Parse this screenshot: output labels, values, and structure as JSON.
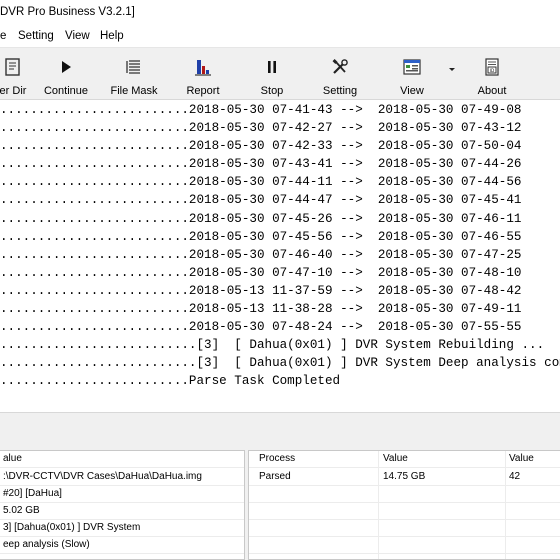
{
  "window": {
    "title": "DVR Pro Business V3.2.1]"
  },
  "menu": [
    "e",
    "Setting",
    "View",
    "Help"
  ],
  "toolbar": {
    "buttons": [
      {
        "name": "enter-dir-button",
        "icon": "folder-icon",
        "label": "er Dir"
      },
      {
        "name": "continue-button",
        "icon": "play-icon",
        "label": "Continue"
      },
      {
        "name": "file-mask-button",
        "icon": "list-icon",
        "label": "File Mask"
      },
      {
        "name": "report-button",
        "icon": "bar-chart-icon",
        "label": "Report"
      },
      {
        "name": "stop-button",
        "icon": "pause-icon",
        "label": "Stop"
      },
      {
        "name": "setting-button",
        "icon": "tools-icon",
        "label": "Setting"
      },
      {
        "name": "view-button",
        "icon": "window-icon",
        "label": "View"
      },
      {
        "name": "about-button",
        "icon": "id-card-icon",
        "label": "About"
      }
    ]
  },
  "log": [
    ".........................2018-05-30 07-41-43 -->  2018-05-30 07-49-08",
    ".........................2018-05-30 07-42-27 -->  2018-05-30 07-43-12",
    ".........................2018-05-30 07-42-33 -->  2018-05-30 07-50-04",
    ".........................2018-05-30 07-43-41 -->  2018-05-30 07-44-26",
    ".........................2018-05-30 07-44-11 -->  2018-05-30 07-44-56",
    ".........................2018-05-30 07-44-47 -->  2018-05-30 07-45-41",
    ".........................2018-05-30 07-45-26 -->  2018-05-30 07-46-11",
    ".........................2018-05-30 07-45-56 -->  2018-05-30 07-46-55",
    ".........................2018-05-30 07-46-40 -->  2018-05-30 07-47-25",
    ".........................2018-05-30 07-47-10 -->  2018-05-30 07-48-10",
    ".........................2018-05-13 11-37-59 -->  2018-05-30 07-48-42",
    ".........................2018-05-13 11-38-28 -->  2018-05-30 07-49-11",
    ".........................2018-05-30 07-48-24 -->  2018-05-30 07-55-55",
    "..........................[3]  [ Dahua(0x01) ] DVR System Rebuilding ...",
    "..........................[3]  [ Dahua(0x01) ] DVR System Deep analysis comple",
    ".........................Parse Task Completed"
  ],
  "left_panel": {
    "header": "alue",
    "rows": [
      ":\\DVR-CCTV\\DVR Cases\\DaHua\\DaHua.img",
      "#20] [DaHua]",
      "5.02 GB",
      "3]  [Dahua(0x01) ] DVR System",
      "eep analysis (Slow)"
    ]
  },
  "right_panel": {
    "headers": [
      "Process",
      "Value",
      "Value"
    ],
    "rows": [
      [
        "Parsed",
        "14.75 GB",
        "42"
      ]
    ]
  }
}
